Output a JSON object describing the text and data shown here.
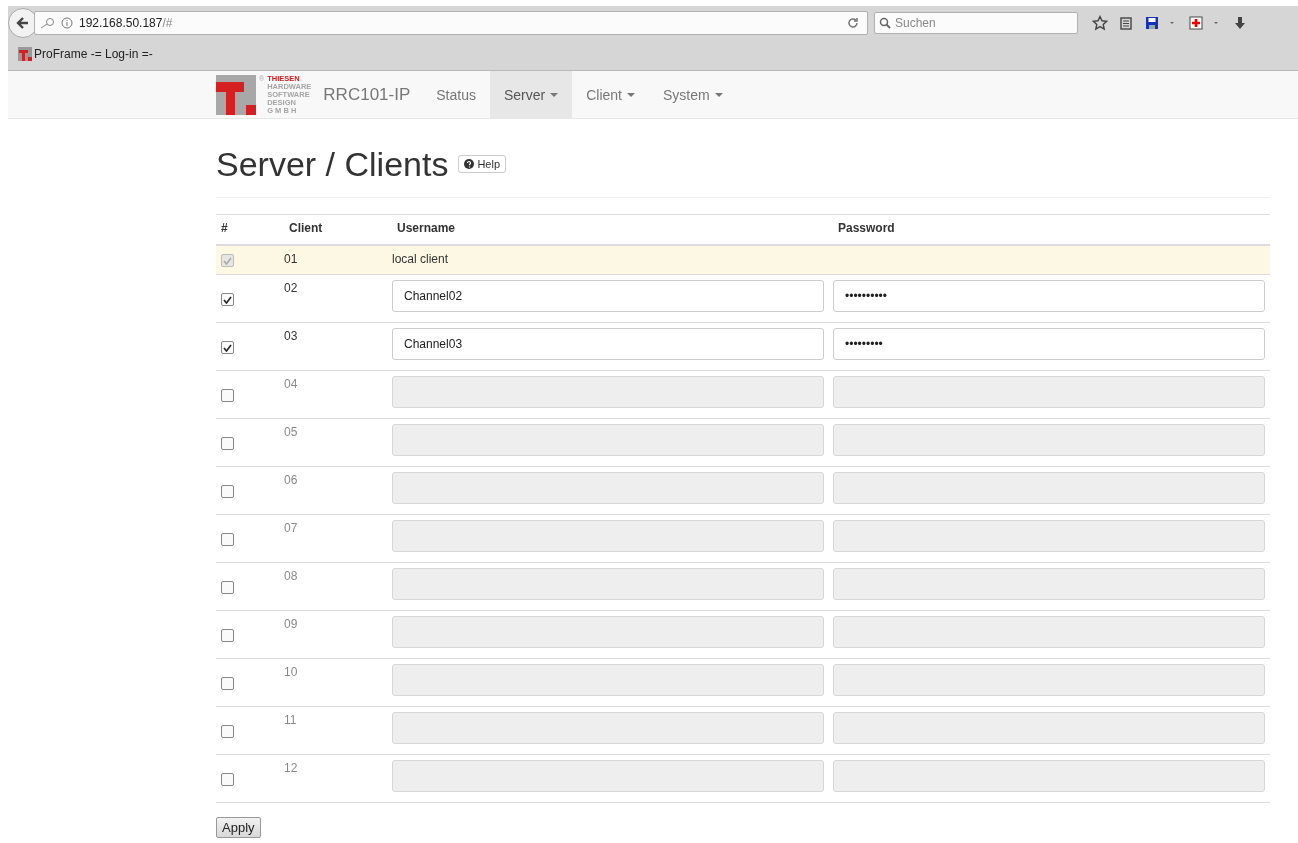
{
  "browser": {
    "url_host": "192.168.50.187",
    "url_path": "/#",
    "search": {
      "placeholder": "Suchen"
    },
    "bookmarks": [
      "ProFrame  -= Log-in =-"
    ]
  },
  "navbar": {
    "logo_mark": "®",
    "logo_lines": [
      "THIESEN",
      "HARDWARE",
      "SOFTWARE",
      "DESIGN",
      "G M B H"
    ],
    "brand": "RRC101-IP",
    "items": [
      {
        "label": "Status",
        "dropdown": false,
        "selected": false
      },
      {
        "label": "Server",
        "dropdown": true,
        "selected": true
      },
      {
        "label": "Client",
        "dropdown": true,
        "selected": false
      },
      {
        "label": "System",
        "dropdown": true,
        "selected": false
      }
    ]
  },
  "page": {
    "title": "Server / Clients",
    "help_button": "Help"
  },
  "table": {
    "columns": [
      "#",
      "Client",
      "Username",
      "Password"
    ],
    "rows": [
      {
        "kind": "local",
        "checked": true,
        "number": "01",
        "username": "local client"
      },
      {
        "kind": "editable",
        "checked": true,
        "number": "02",
        "username": "Channel02",
        "password": "••••••••••"
      },
      {
        "kind": "editable",
        "checked": true,
        "number": "03",
        "username": "Channel03",
        "password": "•••••••••"
      },
      {
        "kind": "editable",
        "checked": false,
        "number": "04"
      },
      {
        "kind": "editable",
        "checked": false,
        "number": "05"
      },
      {
        "kind": "editable",
        "checked": false,
        "number": "06"
      },
      {
        "kind": "editable",
        "checked": false,
        "number": "07"
      },
      {
        "kind": "editable",
        "checked": false,
        "number": "08"
      },
      {
        "kind": "editable",
        "checked": false,
        "number": "09"
      },
      {
        "kind": "editable",
        "checked": false,
        "number": "10"
      },
      {
        "kind": "editable",
        "checked": false,
        "number": "11"
      },
      {
        "kind": "editable",
        "checked": false,
        "number": "12"
      }
    ]
  },
  "apply_button": "Apply"
}
